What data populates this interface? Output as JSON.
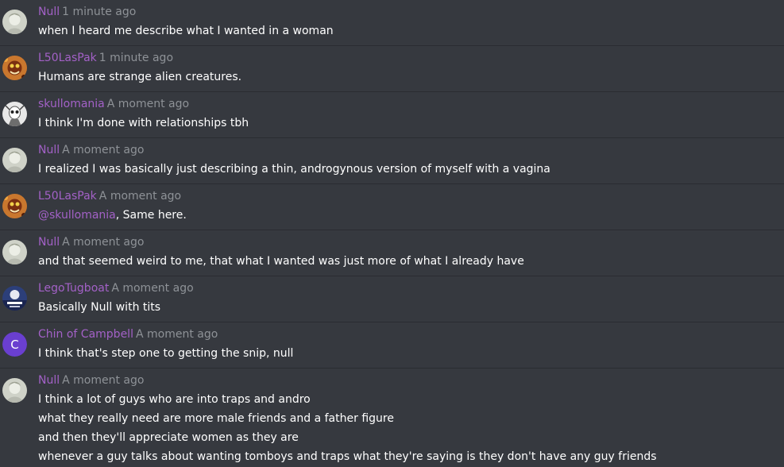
{
  "messages": [
    {
      "author": "Null",
      "time": "1 minute ago",
      "avatar": "null-avatar",
      "lines": [
        "when I heard me describe what I wanted in a woman"
      ]
    },
    {
      "author": "L50LasPak",
      "time": "1 minute ago",
      "avatar": "laspak-avatar",
      "lines": [
        "Humans are strange alien creatures."
      ]
    },
    {
      "author": "skullomania",
      "time": "A moment ago",
      "avatar": "skullomania-avatar",
      "lines": [
        "I think I'm done with relationships tbh"
      ]
    },
    {
      "author": "Null",
      "time": "A moment ago",
      "avatar": "null-avatar",
      "lines": [
        "I realized I was basically just describing a thin, androgynous version of myself with a vagina"
      ]
    },
    {
      "author": "L50LasPak",
      "time": "A moment ago",
      "avatar": "laspak-avatar",
      "mention": "@skullomania",
      "lines": [
        ", Same here."
      ]
    },
    {
      "author": "Null",
      "time": "A moment ago",
      "avatar": "null-avatar",
      "lines": [
        "and that seemed weird to me, that what I wanted was just more of what I already have"
      ]
    },
    {
      "author": "LegoTugboat",
      "time": "A moment ago",
      "avatar": "legotugboat-avatar",
      "lines": [
        "Basically Null with tits"
      ]
    },
    {
      "author": "Chin of Campbell",
      "time": "A moment ago",
      "avatar": "letter-avatar",
      "avatar_letter": "C",
      "lines": [
        "I think that's step one to getting the snip, null"
      ]
    },
    {
      "author": "Null",
      "time": "A moment ago",
      "avatar": "null-avatar",
      "lines": [
        "I think a lot of guys who are into traps and andro",
        "what they really need are more male friends and a father figure",
        "and then they'll appreciate women as they are",
        "whenever a guy talks about wanting tomboys and traps what they're saying is they don't have any guy friends"
      ]
    }
  ],
  "colors": {
    "background": "#36393f",
    "author": "#a361c7",
    "timestamp": "#8e9297",
    "text": "#ffffff",
    "letter_avatar": "#6a3fd0"
  }
}
